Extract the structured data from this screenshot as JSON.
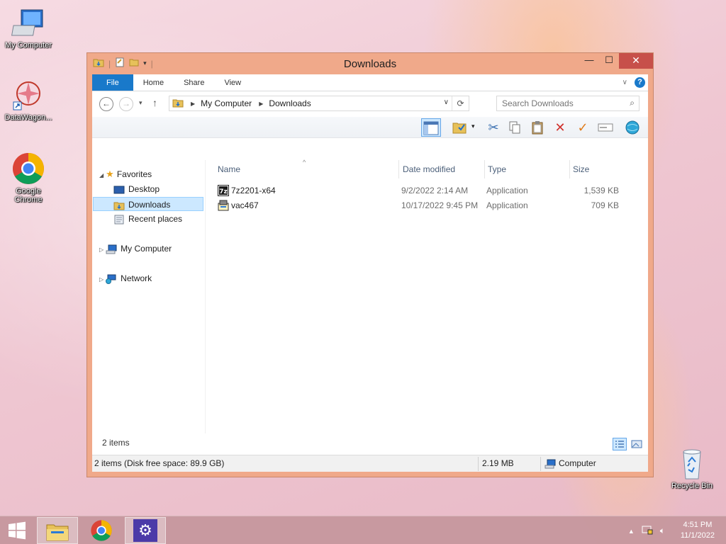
{
  "desktop": {
    "icons": [
      {
        "label": "My Computer"
      },
      {
        "label": "DataWagon..."
      },
      {
        "label": "Google Chrome"
      },
      {
        "label": "Recycle Bin"
      }
    ]
  },
  "window": {
    "title": "Downloads",
    "ribbon_tabs": [
      "File",
      "Home",
      "Share",
      "View"
    ],
    "breadcrumb": [
      "My Computer",
      "Downloads"
    ],
    "search_placeholder": "Search Downloads",
    "nav": {
      "favorites": "Favorites",
      "desktop": "Desktop",
      "downloads": "Downloads",
      "recent": "Recent places",
      "computer": "My Computer",
      "network": "Network"
    },
    "columns": [
      "Name",
      "Date modified",
      "Type",
      "Size"
    ],
    "files": [
      {
        "name": "7z2201-x64",
        "date": "9/2/2022 2:14 AM",
        "type": "Application",
        "size": "1,539 KB"
      },
      {
        "name": "vac467",
        "date": "10/17/2022 9:45 PM",
        "type": "Application",
        "size": "709 KB"
      }
    ],
    "item_count": "2 items",
    "status_left": "2 items (Disk free space: 89.9 GB)",
    "status_size": "2.19 MB",
    "status_location": "Computer"
  },
  "taskbar": {
    "time": "4:51 PM",
    "date": "11/1/2022"
  },
  "colors": {
    "window_frame": "#f0a98a",
    "accent": "#1979ca",
    "close_button": "#c7504a",
    "selection": "#cce8ff"
  }
}
